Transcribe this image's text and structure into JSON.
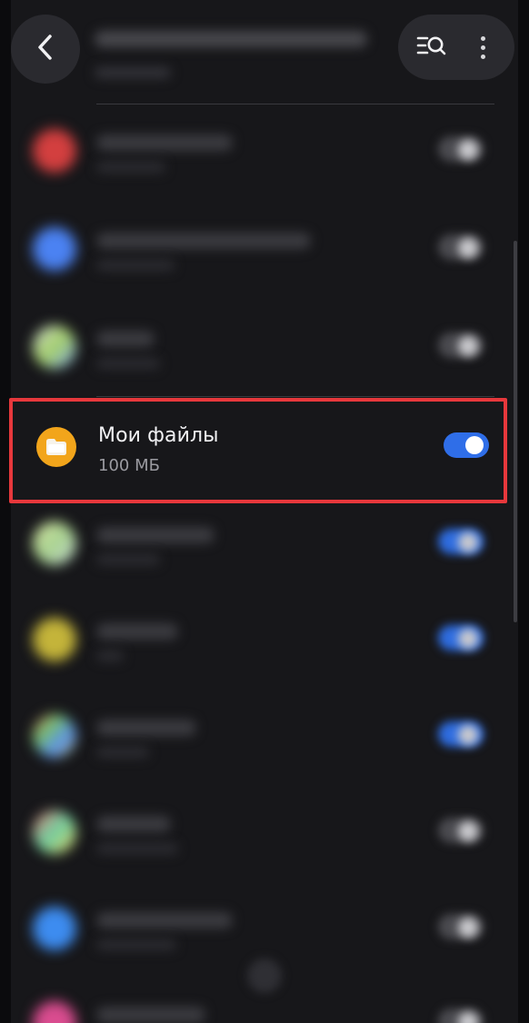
{
  "header": {
    "back_icon": "chevron-left-icon",
    "search_icon": "list-search-icon",
    "more_icon": "more-vertical-icon"
  },
  "highlighted_item": {
    "title": "Мои файлы",
    "size": "100 МБ",
    "toggle_state": "on",
    "icon": "folder-icon",
    "icon_color": "#f2a51b"
  },
  "colors": {
    "accent": "#2f6ee8",
    "highlight_border": "#e7383c",
    "panel": "#17171a"
  }
}
